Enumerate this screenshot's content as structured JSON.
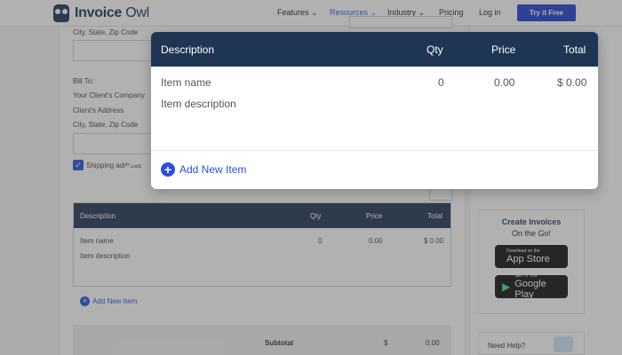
{
  "nav": {
    "logo_brand": "Invoice",
    "logo_owl": "Owl",
    "features": "Features ⌄",
    "resources": "Resources ⌄",
    "industry": "Industry ⌄",
    "pricing": "Pricing",
    "login": "Log in",
    "try_btn": "Try it Free"
  },
  "form": {
    "from_city": "City, State, Zip Code",
    "bill_to": "Bill To:",
    "client_company": "Your Client's Company",
    "client_address": "Client's Address",
    "client_city": "City, State, Zip Code",
    "shipping_label": "Shipping address"
  },
  "items_table": {
    "headers": {
      "description": "Description",
      "qty": "Qty",
      "price": "Price",
      "total": "Total"
    },
    "row": {
      "name": "Item name",
      "description": "Item description",
      "qty": "0",
      "price": "0.00",
      "total": "$ 0.00"
    },
    "add_label": "Add New Item"
  },
  "subtotal": {
    "label": "Subtotal",
    "currency": "$",
    "value": "0.00"
  },
  "sidebar": {
    "card_title": "Create Invoices",
    "card_sub": "On the Go!",
    "app_store_small": "Download on the",
    "app_store_big": "App Store",
    "google_small": "GET IT ON",
    "google_big": "Google Play",
    "help": "Need Help?"
  },
  "modal": {
    "headers": {
      "description": "Description",
      "qty": "Qty",
      "price": "Price",
      "total": "Total"
    },
    "row": {
      "name": "Item name",
      "description": "Item description",
      "qty": "0",
      "price": "0.00",
      "total": "$ 0.00"
    },
    "add_label": "Add New Item"
  },
  "colors": {
    "navy": "#1e3553",
    "accent": "#2b4fd9"
  }
}
